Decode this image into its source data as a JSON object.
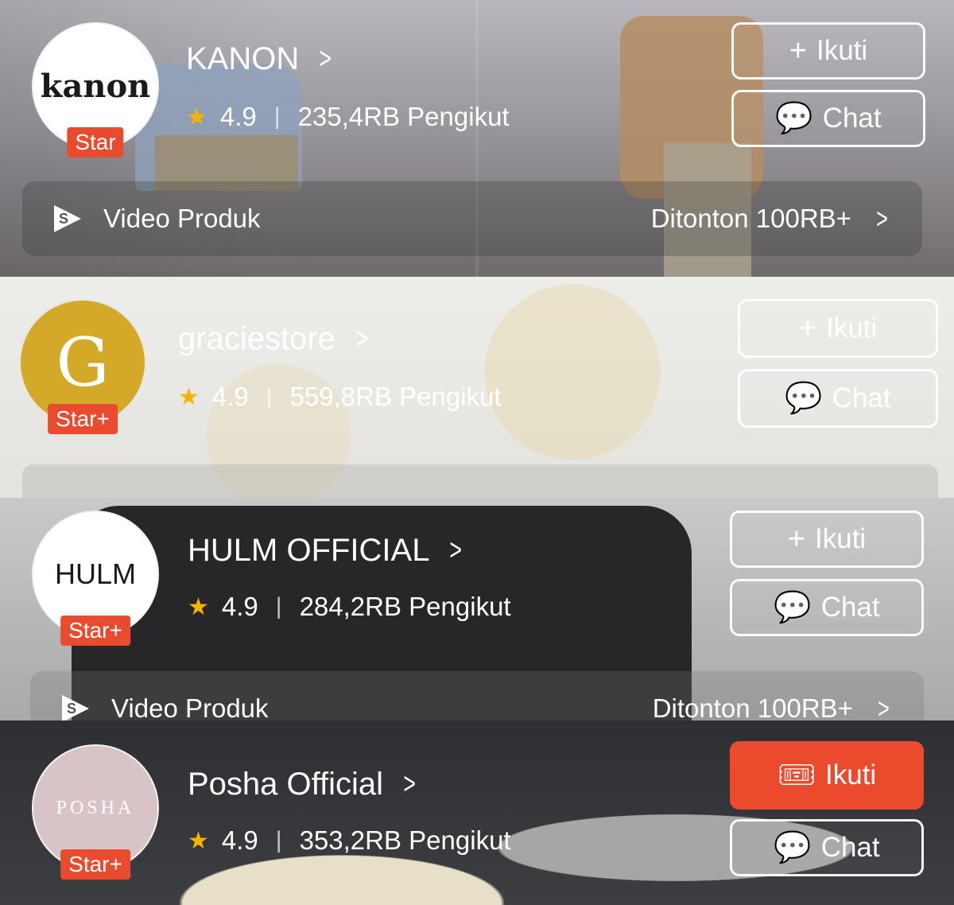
{
  "stores": [
    {
      "name": "KANON",
      "avatar_text": "kanon",
      "badge": "Star",
      "rating": "4.9",
      "followers": "235,4RB Pengikut",
      "follow_label": "Ikuti",
      "chat_label": "Chat",
      "video_label": "Video Produk",
      "views_label": "Ditonton 100RB+"
    },
    {
      "name": "graciestore",
      "avatar_text": "G",
      "badge": "Star+",
      "rating": "4.9",
      "followers": "559,8RB Pengikut",
      "follow_label": "Ikuti",
      "chat_label": "Chat"
    },
    {
      "name": "HULM OFFICIAL",
      "avatar_text": "HULM",
      "badge": "Star+",
      "rating": "4.9",
      "followers": "284,2RB Pengikut",
      "follow_label": "Ikuti",
      "chat_label": "Chat",
      "video_label": "Video Produk",
      "views_label": "Ditonton 100RB+"
    },
    {
      "name": "Posha Official",
      "avatar_text": "POSHA",
      "badge": "Star+",
      "rating": "4.9",
      "followers": "353,2RB Pengikut",
      "follow_label": "Ikuti",
      "chat_label": "Chat"
    }
  ],
  "colors": {
    "badge": "#e94b2e",
    "primary_button": "#ec4a2c",
    "star": "#f5b400"
  }
}
